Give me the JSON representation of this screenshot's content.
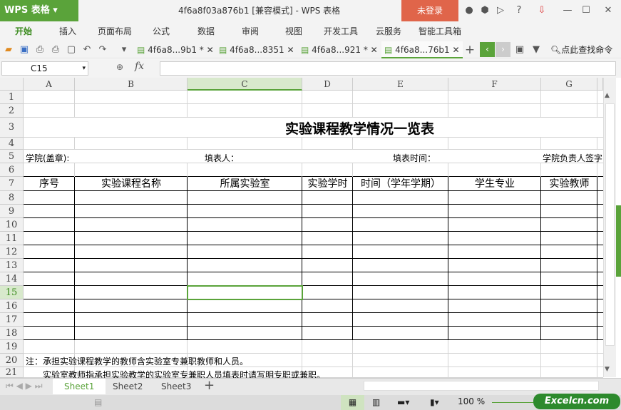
{
  "app": {
    "logo": "WPS 表格",
    "title": "4f6a8f03a876b1 [兼容模式] - WPS 表格",
    "login": "未登录"
  },
  "menu": [
    "开始",
    "插入",
    "页面布局",
    "公式",
    "数据",
    "审阅",
    "视图",
    "开发工具",
    "云服务",
    "智能工具箱"
  ],
  "doc_tabs": [
    {
      "label": "4f6a8...9b1 *"
    },
    {
      "label": "4f6a8...8351"
    },
    {
      "label": "4f6a8...921 *"
    },
    {
      "label": "4f6a8...76b1"
    }
  ],
  "search_label": "点此查找命令",
  "formula": {
    "cell_ref": "C15",
    "fx": "fx",
    "value": ""
  },
  "columns": [
    "A",
    "B",
    "C",
    "D",
    "E",
    "F",
    "G"
  ],
  "rows": [
    "1",
    "2",
    "3",
    "4",
    "5",
    "6",
    "7",
    "8",
    "9",
    "10",
    "11",
    "12",
    "13",
    "14",
    "15",
    "16",
    "17",
    "18",
    "19",
    "20",
    "21"
  ],
  "sheet": {
    "title": "实验课程教学情况一览表",
    "row5": {
      "college": "学院(盖章):",
      "filler": "填表人：",
      "fill_time": "填表时间：",
      "signer": "学院负责人签字"
    },
    "headers": [
      "序号",
      "实验课程名称",
      "所属实验室",
      "实验学时",
      "时间（学年学期）",
      "学生专业",
      "实验教师"
    ],
    "note1": "注：承担实验课程教学的教师含实验室专兼职教师和人员。",
    "note2": "实验室教师指承担实验教学的实验室专兼职人员填表时请写明专职或兼职。"
  },
  "sheet_tabs": [
    "Sheet1",
    "Sheet2",
    "Sheet3"
  ],
  "zoom": "100 %",
  "brand": "Excelcn.com",
  "colors": {
    "accent": "#5aa33a",
    "login": "#e0654a"
  }
}
